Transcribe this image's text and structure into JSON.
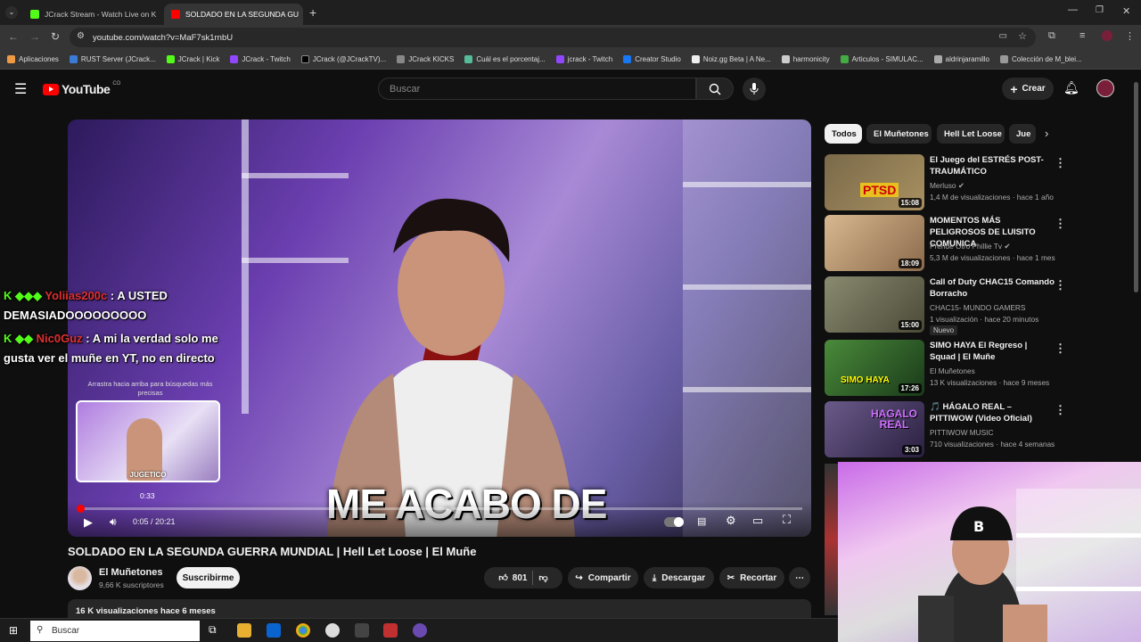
{
  "browser": {
    "tabs": [
      {
        "title": "JCrack Stream - Watch Live on K",
        "active": false
      },
      {
        "title": "SOLDADO EN LA SEGUNDA GU",
        "active": true
      }
    ],
    "url": "youtube.com/watch?v=MaF7sk1rnbU",
    "bookmarks": [
      "Aplicaciones",
      "RUST Server (JCrack...",
      "JCrack | Kick",
      "JCrack - Twitch",
      "JCrack (@JCrackTV)...",
      "JCrack KICKS",
      "Cuál es el porcentaj...",
      "jcrack - Twitch",
      "Creator Studio",
      "Noiz.gg Beta | A Ne...",
      "harmonicity",
      "Articulos - SIMULAC...",
      "aldrinjaramillo",
      "Colección de M_blei..."
    ]
  },
  "youtube": {
    "logo": "YouTube",
    "country": "CO",
    "search_placeholder": "Buscar",
    "create_label": "Crear"
  },
  "player": {
    "caption": "ME ACABO DE",
    "current_time": "0:05 / 20:21",
    "progress_fraction": 0.004,
    "preview_time": "0:33",
    "preview_label": "JUGETICO",
    "drag_tip": "Arrastra hacia arriba para búsquedas más precisas"
  },
  "chat": [
    {
      "user": "Yoliias200c",
      "text": ": A USTED",
      "line2": "DEMASIADOOOOOOOOO"
    },
    {
      "user": "Nic0Guz",
      "text": ": A mi la verdad solo me",
      "line2": "gusta ver el muñe en YT, no en directo"
    }
  ],
  "video": {
    "title": "SOLDADO EN LA SEGUNDA GUERRA MUNDIAL | Hell Let Loose | El Muñe",
    "channel": "El Muñetones",
    "subscribers": "9,66 K suscriptores",
    "subscribe_label": "Suscribirme",
    "likes": "801",
    "share_label": "Compartir",
    "download_label": "Descargar",
    "clip_label": "Recortar",
    "views_date": "16 K visualizaciones  hace 6 meses"
  },
  "chips": [
    "Todos",
    "El Muñetones",
    "Hell Let Loose",
    "Jue"
  ],
  "recommendations": [
    {
      "title": "El Juego del ESTRÉS POST-TRAUMÁTICO",
      "channel": "Merluso",
      "meta": "1,4 M de visualizaciones · hace 1 año",
      "duration": "15:08",
      "thumb_text": "PTSD",
      "color": "#6b5a3a"
    },
    {
      "title": "MOMENTOS MÁS PELIGROSOS DE LUISITO COMUNICA",
      "channel": "Prende Otro Phillie Tv",
      "meta": "5,3 M de visualizaciones · hace 1 mes",
      "duration": "18:09",
      "thumb_text": "",
      "color": "#b08a5a"
    },
    {
      "title": "Call of Duty CHAC15 Comando Borracho",
      "channel": "CHAC15- MUNDO GAMERS",
      "meta": "1 visualización · hace 20 minutos",
      "duration": "15:00",
      "thumb_text": "",
      "color": "#5a6048",
      "badge": "Nuevo"
    },
    {
      "title": "SIMO HAYA El Regreso | Squad | El Muñe",
      "channel": "El Muñetones",
      "meta": "13 K visualizaciones · hace 9 meses",
      "duration": "17:26",
      "thumb_text": "SIMO HAYA",
      "color": "#2d5a2a"
    },
    {
      "title": "🎵 HÁGALO REAL – PITTIWOW (Video Oficial)",
      "channel": "PITTIWOW MUSIC",
      "meta": "710 visualizaciones · hace 4 semanas",
      "duration": "3:03",
      "thumb_text": "HAGALO REAL",
      "color": "#4a3a6a"
    }
  ],
  "taskbar": {
    "search_placeholder": "Buscar"
  }
}
